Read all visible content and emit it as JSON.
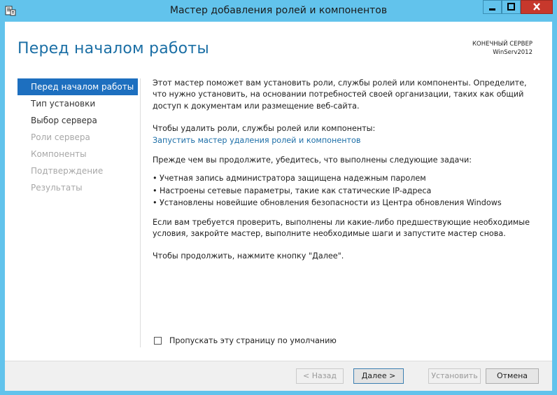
{
  "window": {
    "title": "Мастер добавления ролей и компонентов"
  },
  "header": {
    "page_title": "Перед началом работы",
    "dest_label": "КОНЕЧНЫЙ СЕРВЕР",
    "dest_server": "WinServ2012"
  },
  "nav": {
    "items": [
      {
        "label": "Перед началом работы"
      },
      {
        "label": "Тип установки"
      },
      {
        "label": "Выбор сервера"
      },
      {
        "label": "Роли сервера"
      },
      {
        "label": "Компоненты"
      },
      {
        "label": "Подтверждение"
      },
      {
        "label": "Результаты"
      }
    ]
  },
  "content": {
    "intro": "Этот мастер поможет вам установить роли, службы ролей или компоненты. Определите, что нужно установить, на основании потребностей своей организации, таких как общий доступ к документам или размещение веб-сайта.",
    "remove_text": "Чтобы удалить роли, службы ролей или компоненты:",
    "remove_link": "Запустить мастер удаления ролей и компонентов",
    "tasks_intro": "Прежде чем вы продолжите, убедитесь, что выполнены следующие задачи:",
    "tasks": [
      "Учетная запись администратора защищена надежным паролем",
      "Настроены сетевые параметры, такие как статические IP-адреса",
      "Установлены новейшие обновления безопасности из Центра обновления Windows"
    ],
    "check_text": "Если вам требуется проверить, выполнены ли какие-либо предшествующие необходимые условия, закройте мастер, выполните необходимые шаги и запустите мастер снова.",
    "continue_text": "Чтобы продолжить, нажмите кнопку \"Далее\".",
    "skip_label": "Пропускать эту страницу по умолчанию"
  },
  "footer": {
    "back": "< Назад",
    "next": "Далее >",
    "install": "Установить",
    "cancel": "Отмена"
  }
}
